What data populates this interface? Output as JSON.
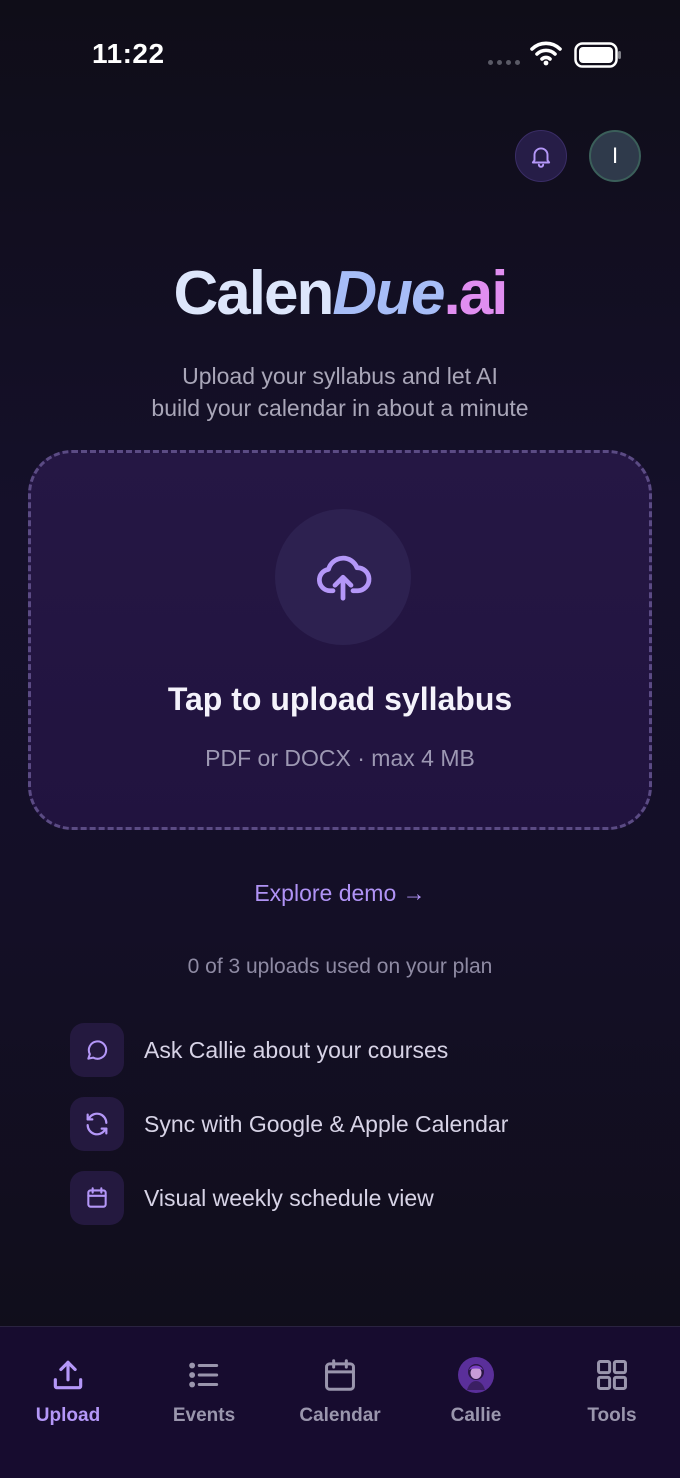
{
  "status_bar": {
    "time": "11:22"
  },
  "header": {
    "avatar_initial": "I"
  },
  "logo": {
    "part1": "Calen",
    "part2": "Due",
    "part3": ".ai"
  },
  "subtitle": {
    "line1": "Upload your syllabus and let AI",
    "line2": "build your calendar in about a minute"
  },
  "upload": {
    "title": "Tap to upload syllabus",
    "subtitle": "PDF or DOCX · max 4 MB"
  },
  "explore_link": "Explore demo →",
  "usage_text": "0 of 3 uploads used on your plan",
  "features": [
    {
      "icon": "chat-bubble-icon",
      "label": "Ask Callie about your courses"
    },
    {
      "icon": "sync-icon",
      "label": "Sync with Google & Apple Calendar"
    },
    {
      "icon": "calendar-icon",
      "label": "Visual weekly schedule view"
    }
  ],
  "tabs": [
    {
      "label": "Upload",
      "icon": "upload-icon",
      "active": true
    },
    {
      "label": "Events",
      "icon": "list-icon",
      "active": false
    },
    {
      "label": "Calendar",
      "icon": "calendar-icon",
      "active": false
    },
    {
      "label": "Callie",
      "icon": "callie-avatar",
      "active": false
    },
    {
      "label": "Tools",
      "icon": "grid-icon",
      "active": false
    }
  ],
  "colors": {
    "accent": "#b497f8",
    "background": "#0f0d18",
    "card": "#251744"
  }
}
